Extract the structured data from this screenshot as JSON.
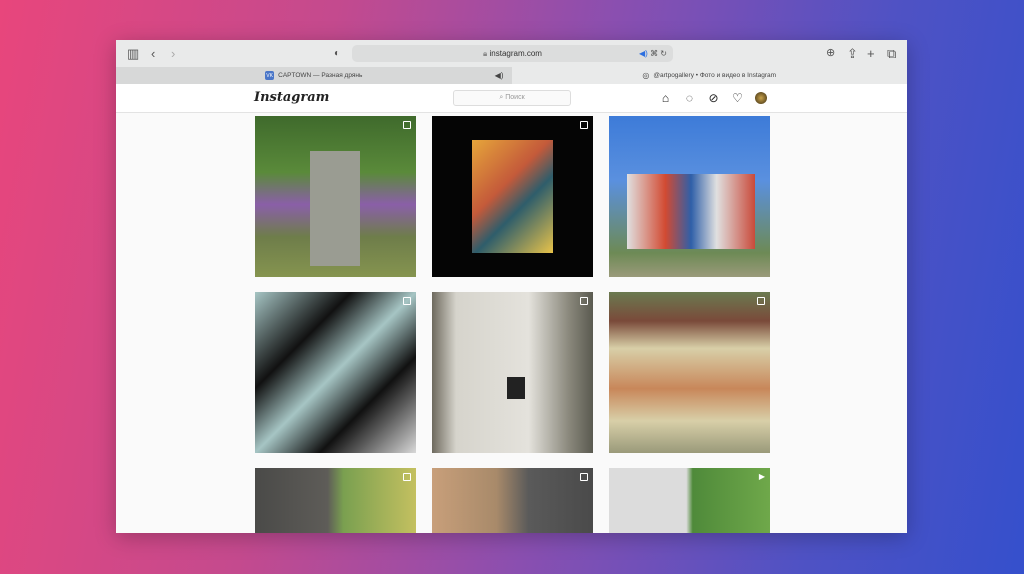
{
  "browser": {
    "url": "instagram.com",
    "tabs": [
      {
        "label": "CAPTOWN — Разная дрянь",
        "favicon": "VK"
      },
      {
        "label": "@artpogallery • Фото и видео в Instagram"
      }
    ]
  },
  "instagram": {
    "logo": "Instagram",
    "search_placeholder": "Поиск"
  }
}
